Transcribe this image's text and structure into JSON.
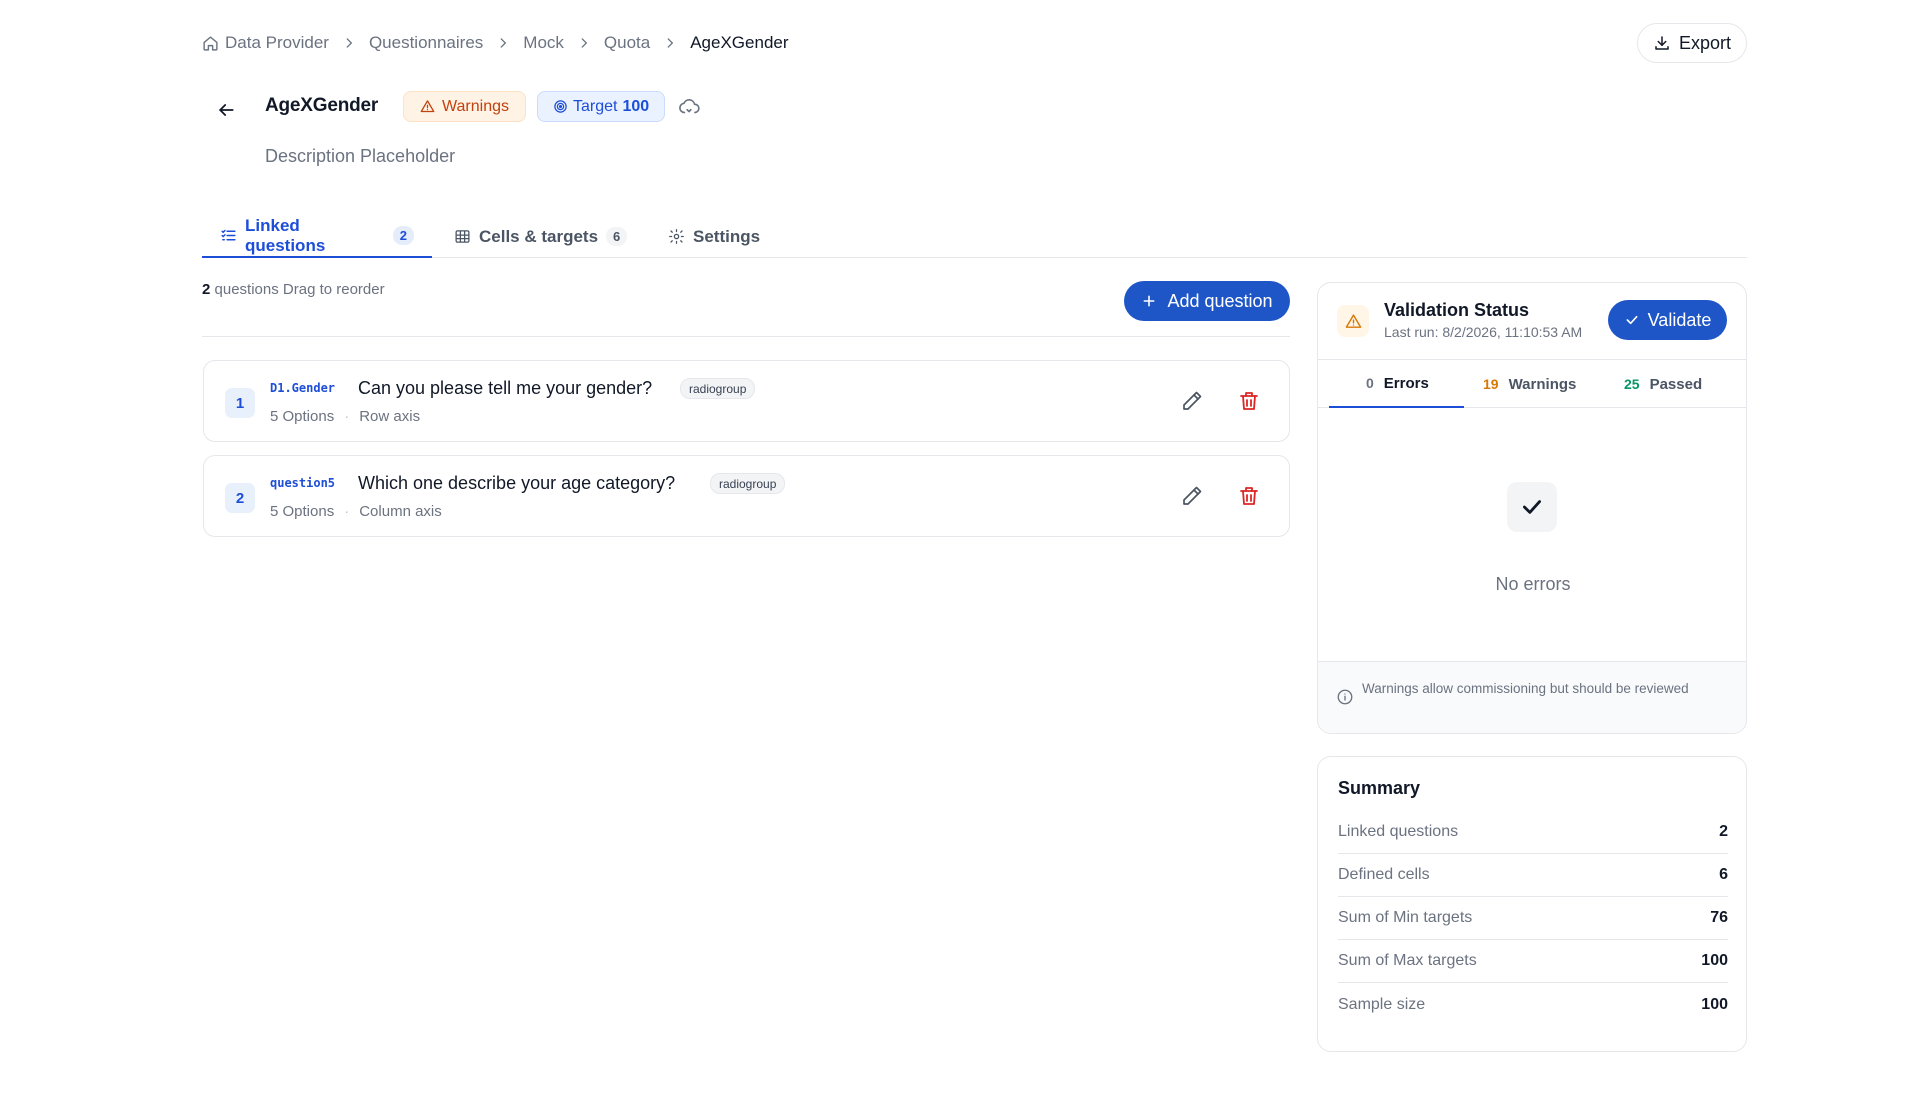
{
  "breadcrumb": {
    "items": [
      "Data Provider",
      "Questionnaires",
      "Mock",
      "Quota"
    ],
    "current": "AgeXGender"
  },
  "header": {
    "export_label": "Export",
    "title": "AgeXGender",
    "warnings_badge": "Warnings",
    "target_label": "Target",
    "target_value": "100",
    "description": "Description Placeholder"
  },
  "tabs": [
    {
      "label": "Linked questions",
      "count": "2"
    },
    {
      "label": "Cells & targets",
      "count": "6"
    },
    {
      "label": "Settings",
      "count": ""
    }
  ],
  "list": {
    "count": "2",
    "meta_text": "questions Drag to reorder",
    "add_label": "Add question"
  },
  "questions": [
    {
      "index": "1",
      "code": "D1.Gender",
      "text": "Can you please tell me your gender?",
      "type": "radiogroup",
      "options": "5 Options",
      "axis": "Row axis"
    },
    {
      "index": "2",
      "code": "question5",
      "text": "Which one describe your age category?",
      "type": "radiogroup",
      "options": "5 Options",
      "axis": "Column axis"
    }
  ],
  "validation": {
    "title": "Validation Status",
    "last_run": "Last run: 8/2/2026, 11:10:53 AM",
    "validate_label": "Validate",
    "tabs": [
      {
        "count": "0",
        "label": "Errors",
        "color": "#6b7280"
      },
      {
        "count": "19",
        "label": "Warnings",
        "color": "#d97706"
      },
      {
        "count": "25",
        "label": "Passed",
        "color": "#059669"
      }
    ],
    "empty_text": "No errors",
    "footer_note": "Warnings allow commissioning but should be reviewed"
  },
  "summary": {
    "title": "Summary",
    "rows": [
      {
        "label": "Linked questions",
        "value": "2"
      },
      {
        "label": "Defined cells",
        "value": "6"
      },
      {
        "label": "Sum of Min targets",
        "value": "76"
      },
      {
        "label": "Sum of Max targets",
        "value": "100"
      },
      {
        "label": "Sample size",
        "value": "100"
      }
    ]
  },
  "colors": {
    "primary": "#1e56c8",
    "warning": "#c2410c",
    "danger": "#dc2626",
    "success": "#059669"
  },
  "icons": [
    "home-icon",
    "chevron-right-icon",
    "download-icon",
    "arrow-left-icon",
    "warning-triangle-icon",
    "target-icon",
    "cloud-sync-icon",
    "list-check-icon",
    "grid-icon",
    "gear-icon",
    "plus-icon",
    "pencil-icon",
    "trash-icon",
    "check-icon",
    "info-icon"
  ]
}
